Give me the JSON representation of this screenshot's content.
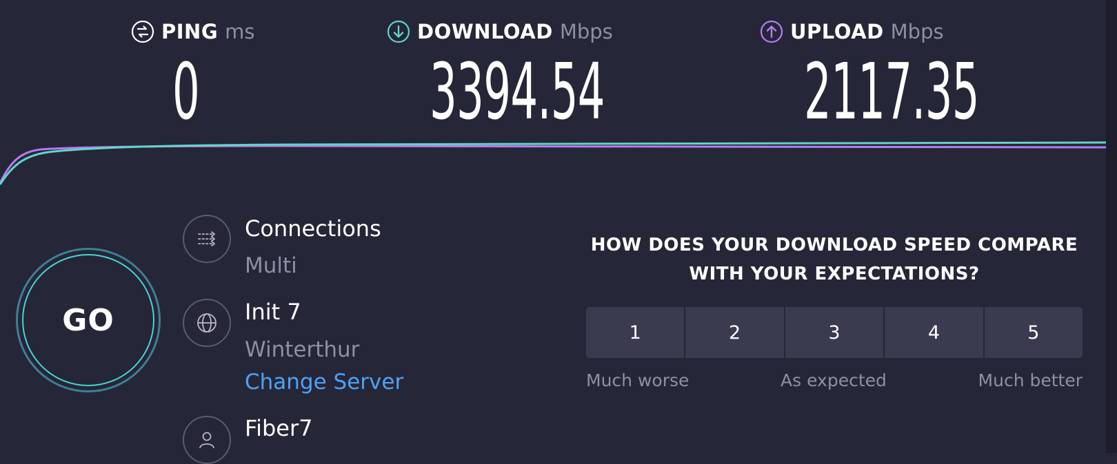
{
  "metrics": {
    "ping": {
      "label": "PING",
      "unit": "ms",
      "value": "0",
      "icon": "ping-icon",
      "color": "#ffffff"
    },
    "download": {
      "label": "DOWNLOAD",
      "unit": "Mbps",
      "value": "3394.54",
      "icon": "download-arrow-icon",
      "color": "#5fd6c8"
    },
    "upload": {
      "label": "UPLOAD",
      "unit": "Mbps",
      "value": "2117.35",
      "icon": "upload-arrow-icon",
      "color": "#b77cf0"
    }
  },
  "go": {
    "label": "GO"
  },
  "connections": {
    "title": "Connections",
    "value": "Multi",
    "icon": "connections-icon"
  },
  "server": {
    "title": "Init 7",
    "location": "Winterthur",
    "change_label": "Change Server",
    "icon": "globe-icon"
  },
  "provider": {
    "title": "Fiber7",
    "icon": "user-icon"
  },
  "survey": {
    "question": "HOW DOES YOUR DOWNLOAD SPEED COMPARE WITH YOUR EXPECTATIONS?",
    "options": [
      "1",
      "2",
      "3",
      "4",
      "5"
    ],
    "hints": {
      "low": "Much worse",
      "mid": "As expected",
      "high": "Much better"
    }
  },
  "colors": {
    "background": "#262639",
    "accent_download": "#5fd6c8",
    "accent_upload": "#b77cf0",
    "link": "#4da3f5"
  }
}
